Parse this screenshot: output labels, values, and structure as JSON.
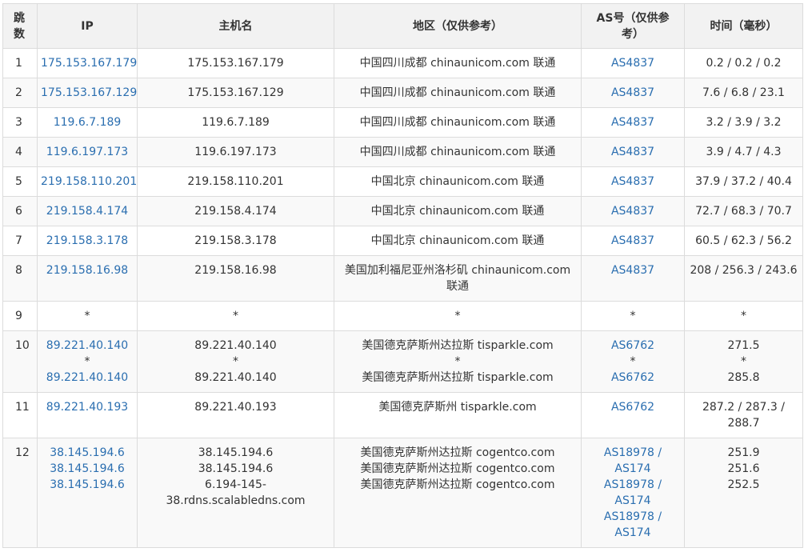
{
  "headers": {
    "hop": [
      "跳",
      "数"
    ],
    "ip": "IP",
    "host": "主机名",
    "region": "地区（仅供参考）",
    "as": [
      "AS号（仅供参",
      "考）"
    ],
    "time": "时间（毫秒）"
  },
  "rows": [
    {
      "hop": "1",
      "ip": [
        "175.153.167.179"
      ],
      "host": [
        "175.153.167.179"
      ],
      "region": [
        "中国四川成都 chinaunicom.com 联通"
      ],
      "as": [
        "AS4837"
      ],
      "time": [
        "0.2 / 0.2 / 0.2"
      ]
    },
    {
      "hop": "2",
      "ip": [
        "175.153.167.129"
      ],
      "host": [
        "175.153.167.129"
      ],
      "region": [
        "中国四川成都 chinaunicom.com 联通"
      ],
      "as": [
        "AS4837"
      ],
      "time": [
        "7.6 / 6.8 / 23.1"
      ]
    },
    {
      "hop": "3",
      "ip": [
        "119.6.7.189"
      ],
      "host": [
        "119.6.7.189"
      ],
      "region": [
        "中国四川成都 chinaunicom.com 联通"
      ],
      "as": [
        "AS4837"
      ],
      "time": [
        "3.2 / 3.9 / 3.2"
      ]
    },
    {
      "hop": "4",
      "ip": [
        "119.6.197.173"
      ],
      "host": [
        "119.6.197.173"
      ],
      "region": [
        "中国四川成都 chinaunicom.com 联通"
      ],
      "as": [
        "AS4837"
      ],
      "time": [
        "3.9 / 4.7 / 4.3"
      ]
    },
    {
      "hop": "5",
      "ip": [
        "219.158.110.201"
      ],
      "host": [
        "219.158.110.201"
      ],
      "region": [
        "中国北京 chinaunicom.com 联通"
      ],
      "as": [
        "AS4837"
      ],
      "time": [
        "37.9 / 37.2 / 40.4"
      ]
    },
    {
      "hop": "6",
      "ip": [
        "219.158.4.174"
      ],
      "host": [
        "219.158.4.174"
      ],
      "region": [
        "中国北京 chinaunicom.com 联通"
      ],
      "as": [
        "AS4837"
      ],
      "time": [
        "72.7 / 68.3 / 70.7"
      ]
    },
    {
      "hop": "7",
      "ip": [
        "219.158.3.178"
      ],
      "host": [
        "219.158.3.178"
      ],
      "region": [
        "中国北京 chinaunicom.com 联通"
      ],
      "as": [
        "AS4837"
      ],
      "time": [
        "60.5 / 62.3 / 56.2"
      ]
    },
    {
      "hop": "8",
      "ip": [
        "219.158.16.98"
      ],
      "host": [
        "219.158.16.98"
      ],
      "region": [
        "美国加利福尼亚州洛杉矶 chinaunicom.com",
        "联通"
      ],
      "as": [
        "AS4837"
      ],
      "time": [
        "208 / 256.3 / 243.6"
      ]
    },
    {
      "hop": "9",
      "ip": [
        "*"
      ],
      "host": [
        "*"
      ],
      "region": [
        "*"
      ],
      "as": [
        "*"
      ],
      "time": [
        "*"
      ]
    },
    {
      "hop": "10",
      "ip": [
        "89.221.40.140",
        "*",
        "89.221.40.140"
      ],
      "host": [
        "89.221.40.140",
        "*",
        "89.221.40.140"
      ],
      "region": [
        "美国德克萨斯州达拉斯 tisparkle.com",
        "*",
        "美国德克萨斯州达拉斯 tisparkle.com"
      ],
      "as": [
        "AS6762",
        "*",
        "AS6762"
      ],
      "time": [
        "271.5",
        "*",
        "285.8"
      ]
    },
    {
      "hop": "11",
      "ip": [
        "89.221.40.193"
      ],
      "host": [
        "89.221.40.193"
      ],
      "region": [
        "美国德克萨斯州 tisparkle.com"
      ],
      "as": [
        "AS6762"
      ],
      "time": [
        "287.2 / 287.3 /",
        "288.7"
      ]
    },
    {
      "hop": "12",
      "ip": [
        "38.145.194.6",
        "38.145.194.6",
        "38.145.194.6"
      ],
      "host": [
        "38.145.194.6",
        "38.145.194.6",
        "6.194-145-",
        "38.rdns.scalabledns.com"
      ],
      "region": [
        "美国德克萨斯州达拉斯 cogentco.com",
        "美国德克萨斯州达拉斯 cogentco.com",
        "美国德克萨斯州达拉斯 cogentco.com"
      ],
      "as": [
        "AS18978 /",
        "AS174",
        "AS18978 /",
        "AS174",
        "AS18978 /",
        "AS174"
      ],
      "time": [
        "251.9",
        "251.6",
        "252.5"
      ]
    }
  ]
}
